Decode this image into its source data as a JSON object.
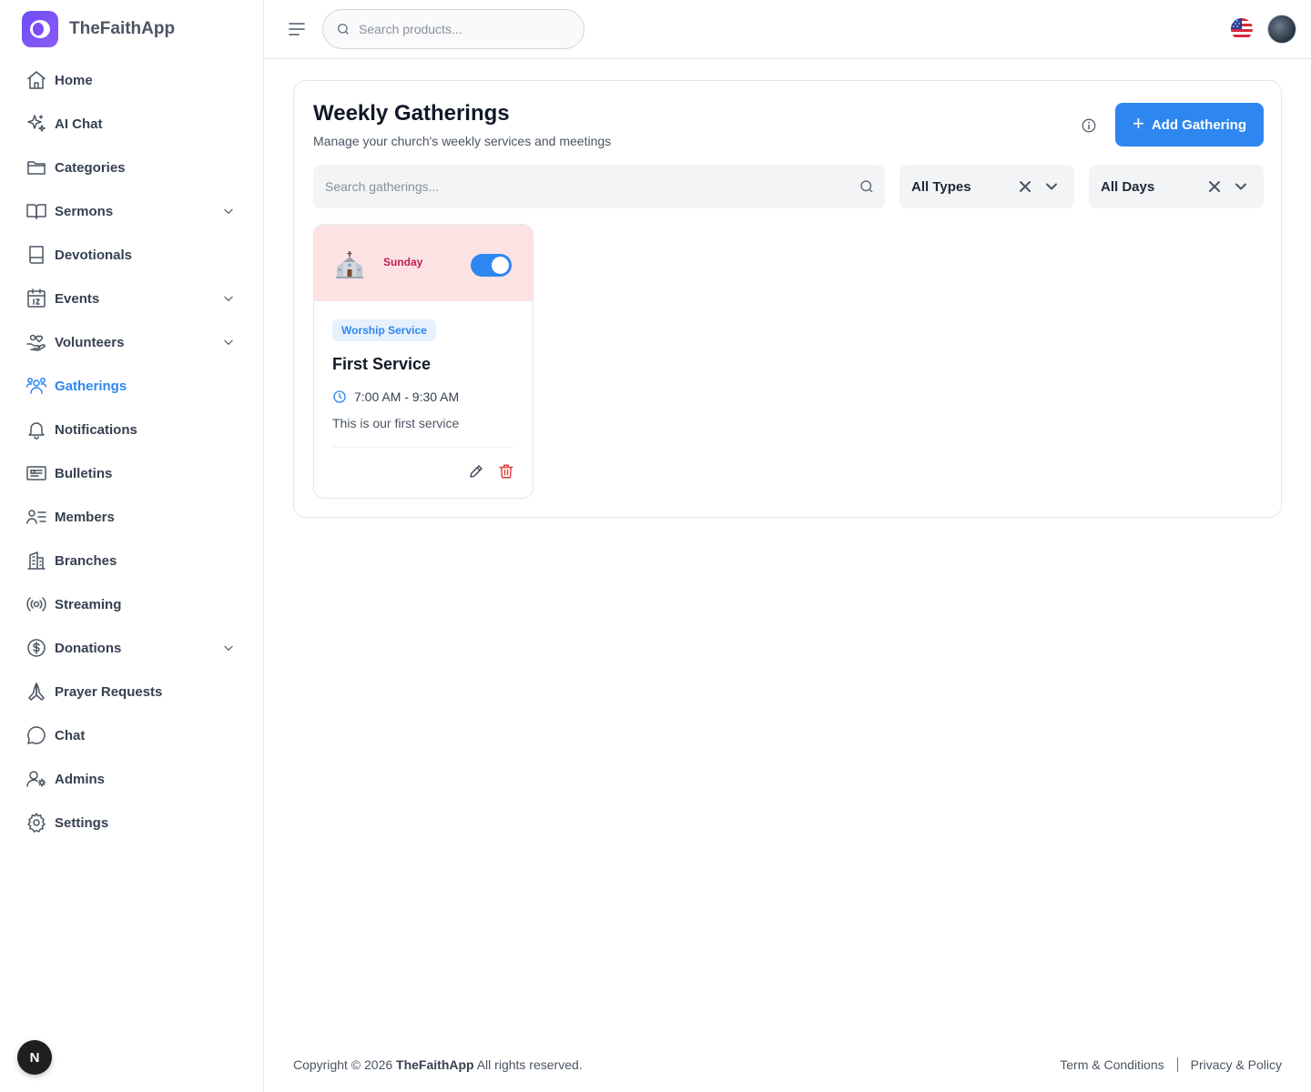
{
  "app": {
    "name": "TheFaithApp"
  },
  "sidebar": {
    "items": [
      {
        "label": "Home",
        "icon": "home-icon",
        "has_chevron": false
      },
      {
        "label": "AI Chat",
        "icon": "sparkle-icon",
        "has_chevron": false
      },
      {
        "label": "Categories",
        "icon": "folder-icon",
        "has_chevron": false
      },
      {
        "label": "Sermons",
        "icon": "book-open-icon",
        "has_chevron": true
      },
      {
        "label": "Devotionals",
        "icon": "book-icon",
        "has_chevron": false
      },
      {
        "label": "Events",
        "icon": "calendar-icon",
        "has_chevron": true
      },
      {
        "label": "Volunteers",
        "icon": "hand-heart-icon",
        "has_chevron": true
      },
      {
        "label": "Gatherings",
        "icon": "users-icon",
        "has_chevron": false,
        "active": true
      },
      {
        "label": "Notifications",
        "icon": "bell-icon",
        "has_chevron": false
      },
      {
        "label": "Bulletins",
        "icon": "newspaper-icon",
        "has_chevron": false
      },
      {
        "label": "Members",
        "icon": "user-list-icon",
        "has_chevron": false
      },
      {
        "label": "Branches",
        "icon": "building-icon",
        "has_chevron": false
      },
      {
        "label": "Streaming",
        "icon": "broadcast-icon",
        "has_chevron": false
      },
      {
        "label": "Donations",
        "icon": "dollar-circle-icon",
        "has_chevron": true
      },
      {
        "label": "Prayer Requests",
        "icon": "praying-hands-icon",
        "has_chevron": false
      },
      {
        "label": "Chat",
        "icon": "chat-bubble-icon",
        "has_chevron": false
      },
      {
        "label": "Admins",
        "icon": "user-gear-icon",
        "has_chevron": false
      },
      {
        "label": "Settings",
        "icon": "gear-icon",
        "has_chevron": false
      }
    ],
    "badge": "N"
  },
  "topbar": {
    "search_placeholder": "Search products..."
  },
  "page": {
    "title": "Weekly Gatherings",
    "subtitle": "Manage your church's weekly services and meetings",
    "add_button": "Add Gathering",
    "search_placeholder": "Search gatherings...",
    "filters": {
      "type": "All Types",
      "day": "All Days"
    }
  },
  "gatherings": [
    {
      "day": "Sunday",
      "enabled": true,
      "type": "Worship Service",
      "title": "First Service",
      "time": "7:00 AM - 9:30 AM",
      "description": "This is our first service"
    }
  ],
  "footer": {
    "copyright_prefix": "Copyright © 2026",
    "copyright_brand": "TheFaithApp",
    "copyright_suffix": "All rights reserved.",
    "terms": "Term & Conditions",
    "privacy": "Privacy & Policy"
  },
  "colors": {
    "accent": "#2e86f0",
    "brand": "#7c4df6",
    "card_header": "#fde2e4",
    "day_text": "#c01f4f",
    "delete": "#e53935"
  }
}
